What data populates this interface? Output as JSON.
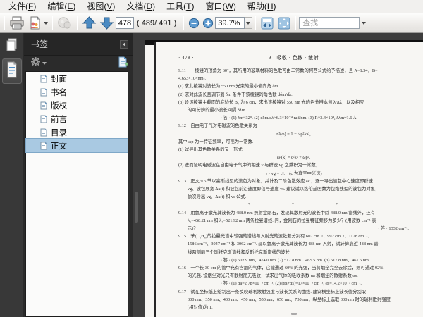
{
  "menu": {
    "items": [
      {
        "label": "文件",
        "key": "F"
      },
      {
        "label": "编辑",
        "key": "E"
      },
      {
        "label": "视图",
        "key": "V"
      },
      {
        "label": "文档",
        "key": "D"
      },
      {
        "label": "工具",
        "key": "T"
      },
      {
        "label": "窗口",
        "key": "W"
      },
      {
        "label": "帮助",
        "key": "H"
      }
    ]
  },
  "toolbar": {
    "page_number": "478",
    "page_count": "( 489/ 491 )",
    "zoom_level": "39.7%",
    "find_placeholder": "查找",
    "colors": {
      "arrow_blue": "#3f7fbe",
      "disabled_gray": "#b8b6b3"
    }
  },
  "sidebar": {
    "title": "书签",
    "bookmarks": [
      {
        "label": "封面"
      },
      {
        "label": "书名"
      },
      {
        "label": "版权"
      },
      {
        "label": "前言"
      },
      {
        "label": "目录"
      },
      {
        "label": "正文"
      }
    ],
    "selected_index": 5,
    "selection_color": "#a9c9e2"
  },
  "doc": {
    "header_left": "· 478 ·",
    "header_center": "9　吸收 · 色散 · 散射",
    "answer_9_14": "· 答 · 1332 cm⁻¹.",
    "lines": [
      "9.11　一棱镜的顶角为 60°，其所用的玻璃材料的色散可由二常数的柯西公式给予描述，且 A=1.54，B=",
      "4.653×10³ nm².",
      "(1) 求此棱镜对波长为 550 nm 光束的最小偏向角 δm.",
      "(2) 求对此波长且调节到 δm 条件下该棱镜的角色散 dδm/dλ.",
      "(3) 设该棱镜主截面的底边长 B₀ 为 6 cm，求出该棱镜对 550 nm 光的色分辨本领 λ/Δλ，以及相应",
      "的可分辨的最小波长间隔 δλm.",
      "· 答 · (1) δm≈32°. (2) dδm/dλ≈6.3×10⁻⁴ rad/nm. (3) R≈3.4×10⁴, δλm≈1.6 Å.",
      "9.12　自由电子气对电磁波的色散关系为",
      "n²(ω) = 1 − ωp²/ω²,",
      "其中 ωp 为一特征频率，可视为一常数.",
      "(1) 试导出其色散关系的又一形式",
      "ω²(k) = c²k² + ωp².",
      "(2) 进而证明电磁波在自由电子气中的相速 v 与群速 vg 之乘积为一常数，",
      "v · vg = c².　(c 为真空中光速)",
      "9.13　正文 9.5 节以高斯线型的波包为对象，并计及二阶色散效应 ω″，逐一导出波包中心速度即群速",
      "vg、波包展宽 Δx(t) 和波包前沿速度即信号速度 vs. 建议试以洛伦兹函数为包络线型的波包为对象，",
      "依次导出 vg、Δx(t) 和 vs 公式.",
      "*                *                *",
      "9.14　用氩离子激光其波长为 488.0 nm 照射金刚石，发现其散射光的波长中除 488.0 nm 谱线外，还有",
      "λ₁=458.21 nm 和 λ₂=521.92 nm 两条拉曼谱线. 问，金刚石的拉曼特征频移为多少？(用波数 cm⁻¹ 表",
      "示)？",
      "9.15　苯(C₆H₆)的拉曼光谱中较强的谱线与入射光的波数差分别有 607 cm⁻¹、992 cm⁻¹、1178 cm⁻¹、",
      "1586 cm⁻¹、3047 cm⁻¹ 和 3062 cm⁻¹. 现以氩离子激光其波长为 488 nm 入射，试计算靠近 488 nm 谱",
      "线两侧前三个斯托克斯谱线和反斯托克斯谱线的波长.",
      "· 答 · (1) 502.9 nm、474.0 nm. (2) 512.8 nm、465.5 nm. (3) 517.8 nm、461.5 nm.",
      "9.16　一个长 30 cm 的管中充有含烟的气体，它能通过 60% 的光强，当将烟全完全去除后，则可通过 92%",
      "的光强. 设烟尘对光只有散射而无吸收，试求出气体的吸收系数 αa 和烟尘的散射系数 αs.",
      "· 答 · (1) αa=2.78×10⁻³ cm⁻¹. (2) (αa+αs)=17×10⁻³ cm⁻¹, αs=14.2×10⁻³ cm⁻¹.",
      "9.17　试在坐标纸上绘制出一条反映瑞利散射强度与波长关系的曲线. 建议横坐标上波长值分别取",
      "300 nm、350 nm、400 nm、450 nm、550 nm、650 nm、750 nm，纵坐标上选取 300 nm 时的瑞利散射强度",
      "(相对值)为 1."
    ]
  }
}
